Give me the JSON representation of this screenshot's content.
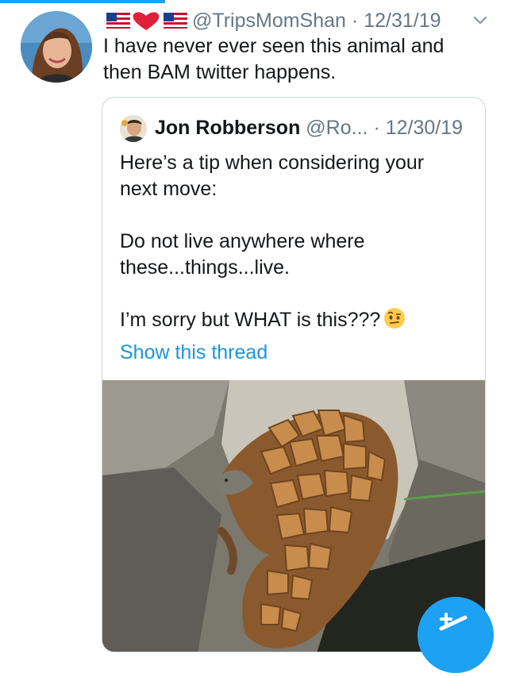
{
  "tweet": {
    "handle": "@TripsMomShan",
    "date": "12/31/19",
    "separator": "·",
    "text_line1": "I have never ever seen this animal and",
    "text_line2": "then BAM twitter happens.",
    "name_emojis": [
      "us-flag-icon",
      "red-heart-icon",
      "us-flag-icon"
    ]
  },
  "quoted_tweet": {
    "name": "Jon Robberson",
    "handle": "@Ro...",
    "separator": "·",
    "date": "12/30/19",
    "line1": "Here’s a tip when considering your",
    "line2": "next move:",
    "line3": "Do not live anywhere where",
    "line4": "these...things...live.",
    "line5": "I’m sorry but WHAT is this???",
    "emoji": "face-with-raised-eyebrow-icon",
    "show_thread": "Show this thread"
  },
  "media": {
    "subject": "pangolin-video-thumbnail"
  },
  "colors": {
    "accent": "#1da1f2",
    "link": "#1b95e0",
    "muted": "#657786",
    "border": "#ccd6dd"
  }
}
